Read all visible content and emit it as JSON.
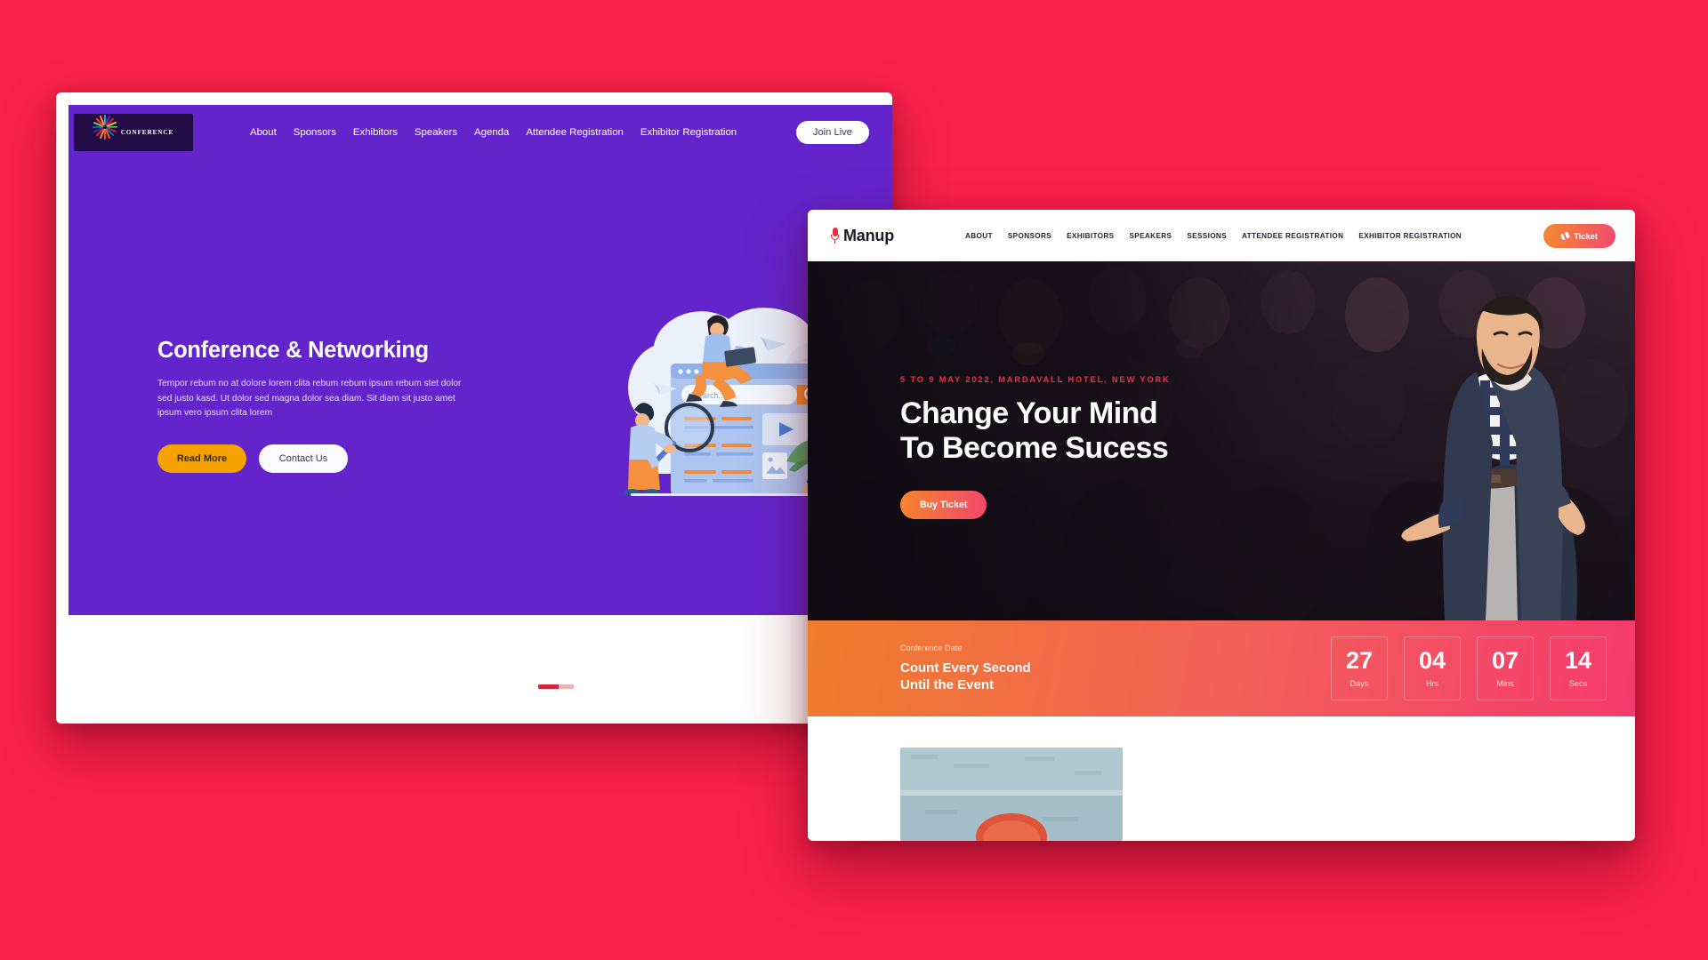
{
  "background_color": "#f8214a",
  "window1": {
    "name": "conference-networking-site",
    "logo": {
      "word": "CONFERENCE",
      "icon": "starburst-icon",
      "bg_color": "#220a45"
    },
    "theme_color": "#6324cc",
    "nav": [
      {
        "label": "About"
      },
      {
        "label": "Sponsors"
      },
      {
        "label": "Exhibitors"
      },
      {
        "label": "Speakers"
      },
      {
        "label": "Agenda"
      },
      {
        "label": "Attendee Registration"
      },
      {
        "label": "Exhibitor Registration"
      }
    ],
    "join_live_label": "Join Live",
    "hero": {
      "title": "Conference & Networking",
      "body": "Tempor rebum no at dolore lorem clita rebum rebum ipsum rebum stet dolor sed justo kasd. Ut dolor sed magna dolor sea diam. Sit diam sit justo amet ipsum vero ipsum clita lorem",
      "primary_button": "Read More",
      "primary_button_color": "#f5a201",
      "secondary_button": "Contact Us",
      "illustration": "search-browser-people-illustration",
      "illustration_search_placeholder": "Search...."
    }
  },
  "window2": {
    "name": "manup-event-site",
    "brand": {
      "name": "Manup",
      "icon": "microphone-icon",
      "icon_color": "#ee2b3f"
    },
    "nav": [
      {
        "label": "ABOUT"
      },
      {
        "label": "SPONSORS"
      },
      {
        "label": "EXHIBITORS"
      },
      {
        "label": "SPEAKERS"
      },
      {
        "label": "SESSIONS"
      },
      {
        "label": "ATTENDEE REGISTRATION"
      },
      {
        "label": "EXHIBITOR REGISTRATION"
      }
    ],
    "ticket_button": {
      "label": "Ticket",
      "icon": "ticket-icon",
      "gradient": [
        "#f58a2e",
        "#f4496f"
      ]
    },
    "hero": {
      "kicker": "5 TO 9 MAY 2022, MARDAVALL HOTEL, NEW YORK",
      "kicker_color": "#ee3246",
      "title_line1": "Change Your Mind",
      "title_line2": "To Become Sucess",
      "buy_button": "Buy Ticket",
      "image": "bearded-man-in-navy-blazer-presenting-before-auditorium-crowd"
    },
    "countdown": {
      "subtitle": "Conference Date",
      "heading_line1": "Count Every Second",
      "heading_line2": "Until the Event",
      "gradient": [
        "#f07c2c",
        "#f53a6d"
      ],
      "units": [
        {
          "value": "27",
          "label": "Days"
        },
        {
          "value": "04",
          "label": "Hrs"
        },
        {
          "value": "07",
          "label": "Mins"
        },
        {
          "value": "14",
          "label": "Secs"
        }
      ]
    },
    "below_fold_image": "red-object-against-light-blue-textured-wall"
  }
}
